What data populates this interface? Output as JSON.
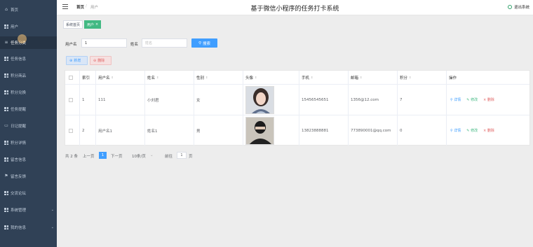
{
  "sidebar": {
    "items": [
      {
        "label": "首页",
        "icon": "home-icon"
      },
      {
        "label": "用户",
        "icon": "grid-icon"
      },
      {
        "label": "任务分类",
        "icon": "list-icon"
      },
      {
        "label": "任务信息",
        "icon": "grid-icon"
      },
      {
        "label": "积分商品",
        "icon": "grid-icon"
      },
      {
        "label": "积分兑换",
        "icon": "grid-icon"
      },
      {
        "label": "任务提醒",
        "icon": "grid-icon"
      },
      {
        "label": "日记提醒",
        "icon": "document-icon"
      },
      {
        "label": "积分详情",
        "icon": "grid-icon"
      },
      {
        "label": "留言信息",
        "icon": "grid-icon"
      },
      {
        "label": "留言反馈",
        "icon": "flag-icon"
      },
      {
        "label": "交流论坛",
        "icon": "grid-icon"
      },
      {
        "label": "系统管理",
        "icon": "grid-icon"
      },
      {
        "label": "我的信息",
        "icon": "grid-icon"
      }
    ]
  },
  "header": {
    "breadcrumb_home": "首页",
    "breadcrumb_separator": "/",
    "breadcrumb_current": "用户",
    "title": "基于微信小程序的任务打卡系统",
    "logout": "退出系统"
  },
  "tags": {
    "home": "系统首页",
    "current": "用户",
    "close": "×"
  },
  "search": {
    "username_label": "用户名",
    "username_value": "1",
    "name_label": "姓名",
    "name_placeholder": "姓名",
    "button": "搜索"
  },
  "actions": {
    "add": "新增",
    "delete": "删除"
  },
  "table": {
    "headers": [
      "索引",
      "用户名",
      "姓名",
      "性别",
      "头像",
      "手机",
      "邮箱",
      "积分",
      "操作"
    ],
    "rows": [
      {
        "index": "1",
        "username": "111",
        "name": "小刘君",
        "gender": "女",
        "phone": "15456545651",
        "email": "1356@12.com",
        "points": "7"
      },
      {
        "index": "2",
        "username": "用户名1",
        "name": "姓名1",
        "gender": "男",
        "phone": "13823888881",
        "email": "773890001@qq.com",
        "points": "0"
      }
    ],
    "ops": {
      "detail": "详情",
      "edit": "修改",
      "delete": "删除"
    }
  },
  "pagination": {
    "total": "共 2 条",
    "prev": "上一页",
    "current": "1",
    "next": "下一页",
    "page_size": "10条/页",
    "goto_label": "前往",
    "goto_value": "1",
    "page_unit": "页"
  },
  "colors": {
    "sidebar_bg": "#304156",
    "primary": "#409eff",
    "success": "#42b983",
    "danger": "#e06060"
  }
}
